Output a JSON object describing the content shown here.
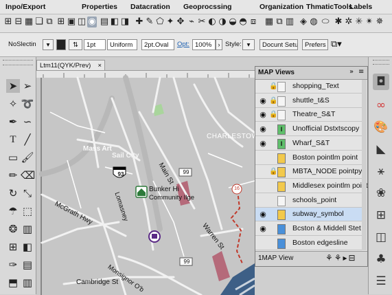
{
  "menus": [
    "Inpo/Export",
    "Properties",
    "Datacration",
    "Geoprocssing",
    "Organization",
    "ThmaticTools",
    "Labels"
  ],
  "control_bar": {
    "selection": "NoSlectin",
    "stroke_weight": "1pt",
    "stroke_profile": "Uniform",
    "brush": "2pt.Oval",
    "opacity_label": "Opt:",
    "opacity": "100%",
    "style_label": "Style:",
    "document_setup": "Docunt Setup",
    "preferences": "Prefers"
  },
  "document_tab": {
    "title": "Ltm11(QYK/Prev)",
    "close": "×"
  },
  "map_labels": {
    "charlestown": "CHARLESTOW",
    "mass_art": "Mass Art",
    "sail_city": "Sail City",
    "main_st": "Main St",
    "bunker_hill": "Bunker Hi",
    "community_college": "Community Ilge",
    "mcgrath_hwy": "McGrath Hwy",
    "lomasney_way": "Lomasney",
    "warren_st": "Warren St",
    "monsignor": "Monsignor O'b",
    "cambridge_st": "Cambridge St",
    "route_93": "93",
    "route_99a": "99",
    "route_99b": "99",
    "route_16": "16"
  },
  "layers_panel": {
    "title": "MAP Views",
    "layers": [
      {
        "name": "shopping_Text",
        "eye": false,
        "lock": true,
        "type": ""
      },
      {
        "name": "shuttle_t&S",
        "eye": true,
        "lock": true,
        "type": ""
      },
      {
        "name": "Theatre_S&T",
        "eye": true,
        "lock": true,
        "type": ""
      },
      {
        "name": "Unofficial Dstxtscopy",
        "eye": true,
        "lock": false,
        "type": "I"
      },
      {
        "name": "Wharf_S&T",
        "eye": true,
        "lock": false,
        "type": "I"
      },
      {
        "name": "Boston pointlm point",
        "eye": false,
        "lock": false,
        "type": "P"
      },
      {
        "name": "MBTA_NODE pointpy",
        "eye": false,
        "lock": true,
        "type": "P"
      },
      {
        "name": "Middlesex pointlm point",
        "eye": false,
        "lock": false,
        "type": "P"
      },
      {
        "name": "schools_point",
        "eye": false,
        "lock": false,
        "type": ""
      },
      {
        "name": "subway_symbol",
        "eye": true,
        "lock": false,
        "type": "P",
        "selected": true
      },
      {
        "name": "Bcston & Middell Stet",
        "eye": true,
        "lock": false,
        "type": "L"
      },
      {
        "name": "Boston edgesline",
        "eye": false,
        "lock": false,
        "type": "L"
      }
    ],
    "footer": "1MAP View"
  },
  "colors": {
    "accent_selection": "#c9dcf3",
    "type_point": "#f2c94c",
    "type_line": "#4a90d9",
    "type_text": "#5fbf6b",
    "route_red": "#c0392b",
    "water": "#3d5f86",
    "park": "#a9d59c",
    "building": "#b56a7a"
  },
  "icons": [
    "select-arrow",
    "direct-select",
    "magic-wand",
    "lasso",
    "pen",
    "curvature",
    "type",
    "line",
    "rectangle",
    "brush",
    "pencil",
    "eraser",
    "rotate",
    "scale",
    "warp",
    "free-transform",
    "symbol-sprayer",
    "graph",
    "mesh",
    "gradient",
    "eyedropper",
    "blend",
    "artboard",
    "slice"
  ]
}
